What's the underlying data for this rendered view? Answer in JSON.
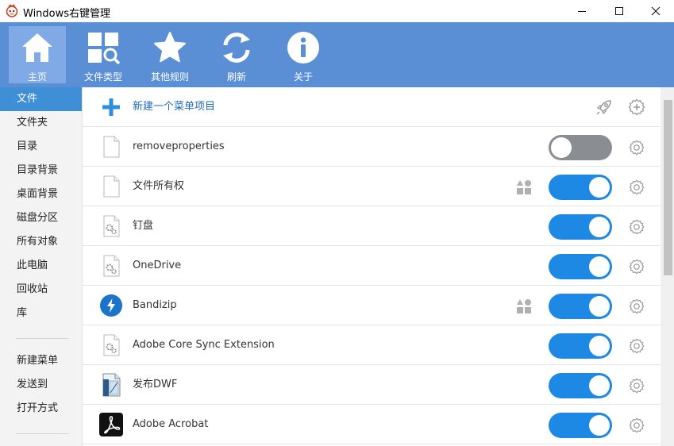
{
  "window": {
    "title": "Windows右键管理",
    "icon": "app-logo-icon",
    "controls": [
      "minimize-icon",
      "maximize-icon",
      "close-icon"
    ]
  },
  "toolbar": {
    "items": [
      {
        "label": "主页",
        "icon": "home-icon",
        "active": true
      },
      {
        "label": "文件类型",
        "icon": "file-types-icon",
        "active": false
      },
      {
        "label": "其他规则",
        "icon": "star-icon",
        "active": false
      },
      {
        "label": "刷新",
        "icon": "refresh-icon",
        "active": false
      },
      {
        "label": "关于",
        "icon": "info-icon",
        "active": false
      }
    ],
    "color": "#5a8fd6"
  },
  "sidebar": {
    "items": [
      {
        "label": "文件",
        "active": true
      },
      {
        "label": "文件夹"
      },
      {
        "label": "目录"
      },
      {
        "label": "目录背景"
      },
      {
        "label": "桌面背景"
      },
      {
        "label": "磁盘分区"
      },
      {
        "label": "所有对象"
      },
      {
        "label": "此电脑"
      },
      {
        "label": "回收站"
      },
      {
        "label": "库"
      }
    ],
    "items2": [
      {
        "label": "新建菜单"
      },
      {
        "label": "发送到"
      },
      {
        "label": "打开方式"
      }
    ],
    "active_color": "#3f8fd6"
  },
  "main": {
    "new_item_label": "新建一个菜单项目",
    "rows": [
      {
        "label": "removeproperties",
        "icon": "blank-file-icon",
        "enabled": false,
        "shapes": false
      },
      {
        "label": "文件所有权",
        "icon": "blank-file-icon",
        "enabled": true,
        "shapes": true
      },
      {
        "label": "钉盘",
        "icon": "settings-file-icon",
        "enabled": true,
        "shapes": false
      },
      {
        "label": "OneDrive",
        "icon": "settings-file-icon",
        "enabled": true,
        "shapes": false
      },
      {
        "label": "Bandizip",
        "icon": "bandizip-icon",
        "enabled": true,
        "shapes": true
      },
      {
        "label": "Adobe Core Sync Extension",
        "icon": "settings-file-icon",
        "enabled": true,
        "shapes": false
      },
      {
        "label": "发布DWF",
        "icon": "dwf-file-icon",
        "enabled": true,
        "shapes": false
      },
      {
        "label": "Adobe Acrobat",
        "icon": "acrobat-icon",
        "enabled": true,
        "shapes": false
      }
    ],
    "toggle_on_color": "#1e88e5",
    "toggle_off_color": "#8a8d91"
  }
}
